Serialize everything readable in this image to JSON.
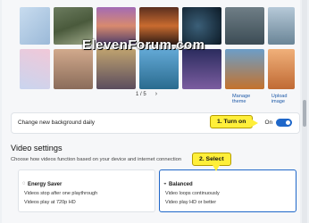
{
  "gallery": {
    "page_indicator": "1 / 5",
    "manage_theme": "Manage theme",
    "upload_image": "Upload image",
    "watermark": "ElevenForum.com"
  },
  "daily": {
    "label": "Change new background daily",
    "toggle_state": "On"
  },
  "video": {
    "title": "Video settings",
    "subtitle": "Choose how videos function based on your device and internet connection",
    "options": [
      {
        "name": "Energy Saver",
        "line1": "Videos stop after one playthrough",
        "line2": "Videos play at 720p HD"
      },
      {
        "name": "Balanced",
        "line1": "Video loops continuously",
        "line2": "Video play HD or better"
      }
    ]
  },
  "callouts": {
    "one": "1. Turn on",
    "two": "2. Select"
  },
  "colors": {
    "accent": "#1f67c9",
    "callout": "#ffef3a"
  }
}
